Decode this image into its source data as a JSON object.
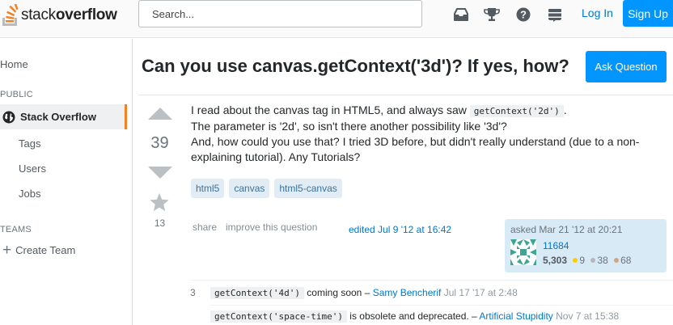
{
  "header": {
    "logo_pre": "stack",
    "logo_bold": "overflow",
    "search_placeholder": "Search...",
    "icons": [
      "inbox-icon",
      "trophy-icon",
      "help-icon",
      "stack-exchange-icon"
    ],
    "login_label": "Log In",
    "signup_label": "Sign Up"
  },
  "sidebar": {
    "home": "Home",
    "public_heading": "PUBLIC",
    "stack_overflow": "Stack Overflow",
    "tags": "Tags",
    "users": "Users",
    "jobs": "Jobs",
    "teams_heading": "TEAMS",
    "create_team": "Create Team"
  },
  "question": {
    "title": "Can you use canvas.getContext('3d')? If yes, how?",
    "ask_button": "Ask Question",
    "votes": "39",
    "favorites": "13",
    "body": {
      "line1_text": "I read about the canvas tag in HTML5, and always saw ",
      "line1_code": "getContext('2d')",
      "line1_end": ".",
      "line2": "The parameter is '2d', so isn't there another possibility like '3d'?",
      "line3": "And, how could you use that? I tried 3D before, but didn't really understand (due to a non-explaining tutorial). Any Tutorials?"
    },
    "tags": [
      "html5",
      "canvas",
      "html5-canvas"
    ],
    "share": "share",
    "improve": "improve this question",
    "edited": "edited Jul 9 '12 at 16:42",
    "owner": {
      "asked": "asked Mar 21 '12 at 20:21",
      "name": "11684",
      "reputation": "5,303",
      "gold": "9",
      "silver": "38",
      "bronze": "68"
    }
  },
  "comments": [
    {
      "score": "3",
      "code": "getContext('4d')",
      "text": " coming soon – ",
      "author": "Samy Bencherif",
      "date": " Jul 17 '17 at 2:48"
    },
    {
      "score": "",
      "code": "getContext('space-time')",
      "text": " is obsolete and deprecated. – ",
      "author": "Artificial Stupidity",
      "date": " Nov 7 at 15:38"
    }
  ],
  "colors": {
    "accent_orange": "#f48024",
    "link_blue": "#0077cc",
    "button_blue": "#0095ff",
    "tag_bg": "#e1ecf4"
  }
}
